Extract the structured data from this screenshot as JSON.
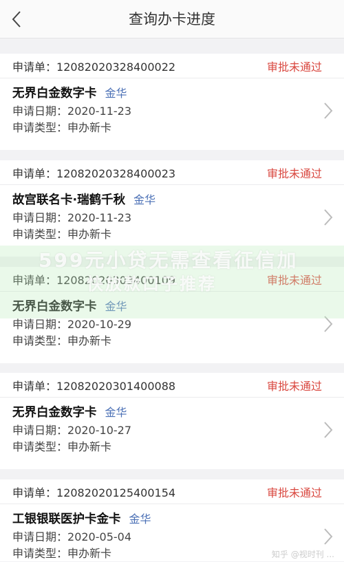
{
  "header": {
    "back_icon": "chevron-left-icon",
    "title": "查询办卡进度"
  },
  "applications": [
    {
      "app_label": "申请单：",
      "app_no": "12082020328400022",
      "status": "审批未通过",
      "card_name": "无界白金数字卡",
      "tier": "金华",
      "date_label": "申请日期：",
      "date": "2020-11-23",
      "type_label": "申请类型：",
      "type": "申办新卡"
    },
    {
      "app_label": "申请单：",
      "app_no": "12082020328400023",
      "status": "审批未通过",
      "card_name": "故宫联名卡·瑞鹤千秋",
      "tier": "金华",
      "date_label": "申请日期：",
      "date": "2020-11-23",
      "type_label": "申请类型：",
      "type": "申办新卡"
    },
    {
      "app_label": "申请单：",
      "app_no": "12082020303400109",
      "status": "审批未通过",
      "card_name": "无界白金数字卡",
      "tier": "金华",
      "date_label": "申请日期：",
      "date": "2020-10-29",
      "type_label": "申请类型：",
      "type": "申办新卡"
    },
    {
      "app_label": "申请单：",
      "app_no": "12082020301400088",
      "status": "审批未通过",
      "card_name": "无界白金数字卡",
      "tier": "金华",
      "date_label": "申请日期：",
      "date": "2020-10-27",
      "type_label": "申请类型：",
      "type": "申办新卡"
    },
    {
      "app_label": "申请单：",
      "app_no": "12082020125400154",
      "status": "审批未通过",
      "card_name": "工银银联医护卡金卡",
      "tier": "金华",
      "date_label": "申请日期：",
      "date": "2020-05-04",
      "type_label": "申请类型：",
      "type": "申办新卡"
    }
  ],
  "overlay": {
    "line1": "599元小贷无需查看征信加",
    "line2": "快放款口子推荐"
  },
  "credit": "知乎 @视时刊 ...",
  "colors": {
    "status_red": "#d9473f",
    "tier_blue": "#4a6fb5",
    "page_bg": "#f2f2f4"
  }
}
